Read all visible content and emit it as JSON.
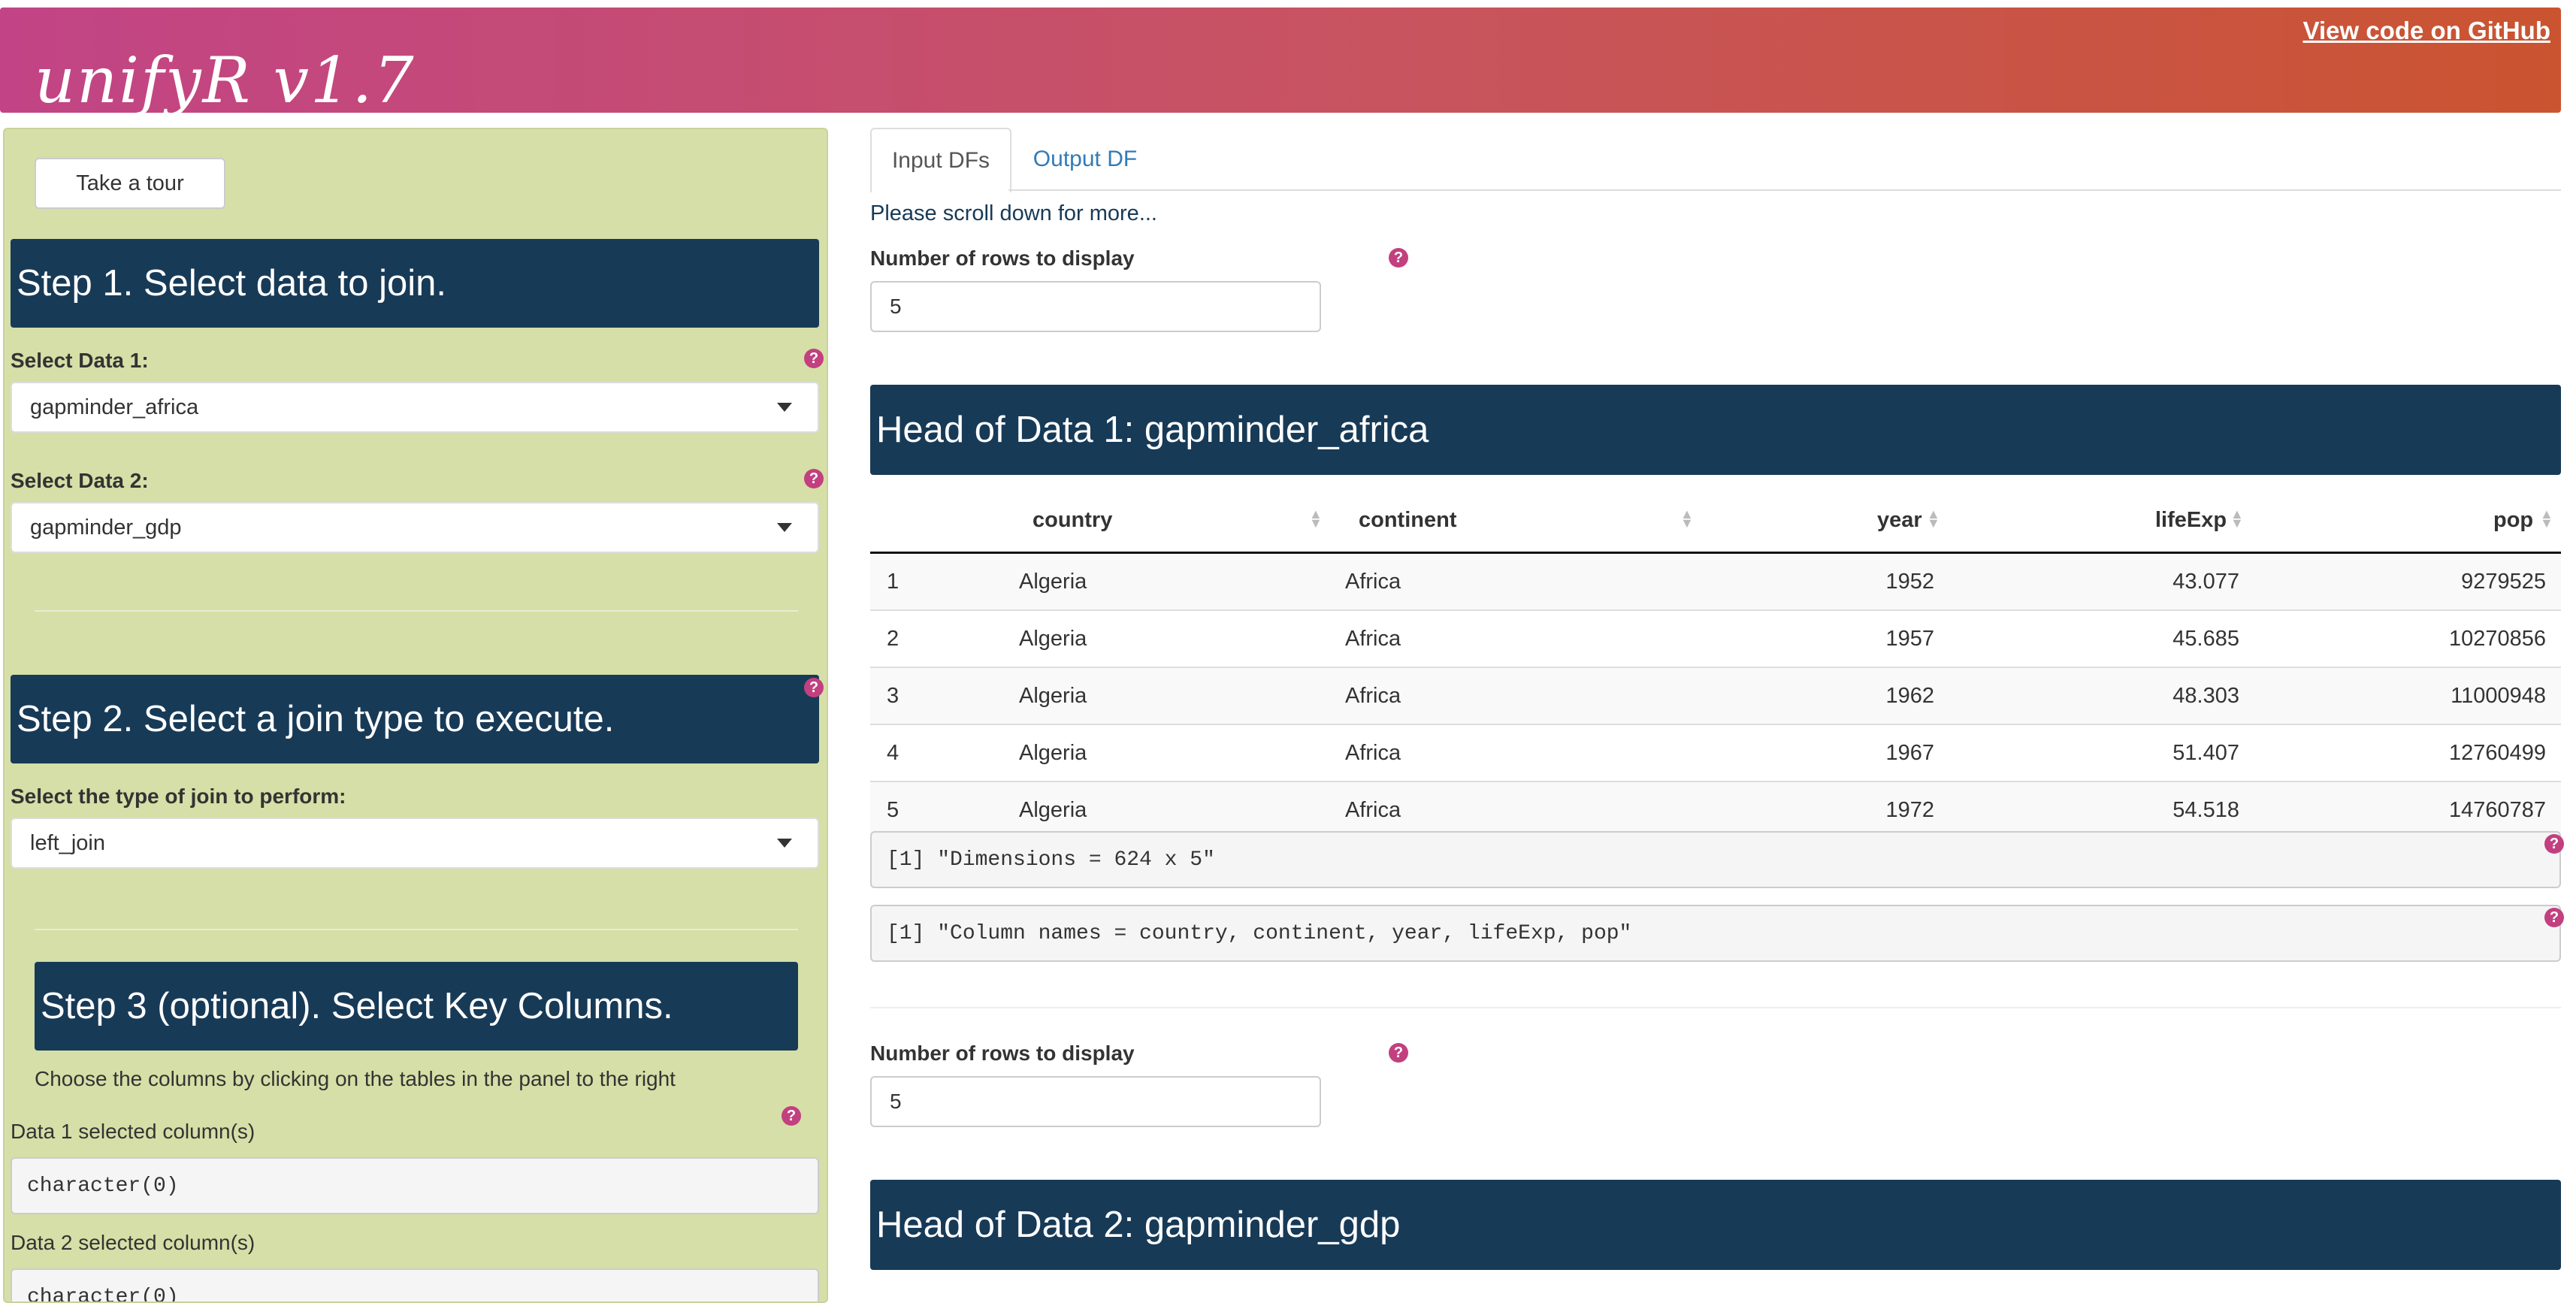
{
  "header": {
    "title": "unifyR v1.7",
    "github_link": "View code on GitHub",
    "gradient_colors": [
      "#c24486",
      "#ca5430"
    ]
  },
  "sidebar": {
    "tour_button": "Take a tour",
    "step1": {
      "title": "Step 1. Select data to join.",
      "data1_label": "Select Data 1:",
      "data1_value": "gapminder_africa",
      "data2_label": "Select Data 2:",
      "data2_value": "gapminder_gdp"
    },
    "step2": {
      "title": "Step 2. Select a join type to execute.",
      "join_label": "Select the type of join to perform:",
      "join_value": "left_join"
    },
    "step3": {
      "title": "Step 3 (optional). Select Key Columns.",
      "instructions": "Choose the columns by clicking on the tables in the panel to the right",
      "data1_cols_label": "Data 1 selected column(s)",
      "data1_cols_value": "character(0)",
      "data2_cols_label": "Data 2 selected column(s)",
      "data2_cols_value": "character(0)"
    }
  },
  "main": {
    "tabs": [
      {
        "label": "Input DFs",
        "active": true
      },
      {
        "label": "Output DF",
        "active": false
      }
    ],
    "scroll_hint": "Please scroll down for more...",
    "rows_label": "Number of rows to display",
    "rows_value": "5",
    "data1_heading": "Head of Data 1: gapminder_africa",
    "table1": {
      "columns": [
        "",
        "country",
        "continent",
        "year",
        "lifeExp",
        "pop"
      ],
      "rows": [
        [
          "1",
          "Algeria",
          "Africa",
          "1952",
          "43.077",
          "9279525"
        ],
        [
          "2",
          "Algeria",
          "Africa",
          "1957",
          "45.685",
          "10270856"
        ],
        [
          "3",
          "Algeria",
          "Africa",
          "1962",
          "48.303",
          "11000948"
        ],
        [
          "4",
          "Algeria",
          "Africa",
          "1967",
          "51.407",
          "12760499"
        ],
        [
          "5",
          "Algeria",
          "Africa",
          "1972",
          "54.518",
          "14760787"
        ]
      ]
    },
    "dimensions_text": "[1] \"Dimensions = 624 x 5\"",
    "colnames_text": "[1] \"Column names = country, continent, year, lifeExp, pop\"",
    "rows2_label": "Number of rows to display",
    "rows2_value": "5",
    "data2_heading": "Head of Data 2: gapminder_gdp"
  },
  "colors": {
    "banner": "#173a57",
    "sidebar_bg": "#d5dfa7",
    "help_icon": "#c2407f",
    "link": "#337ab7"
  }
}
